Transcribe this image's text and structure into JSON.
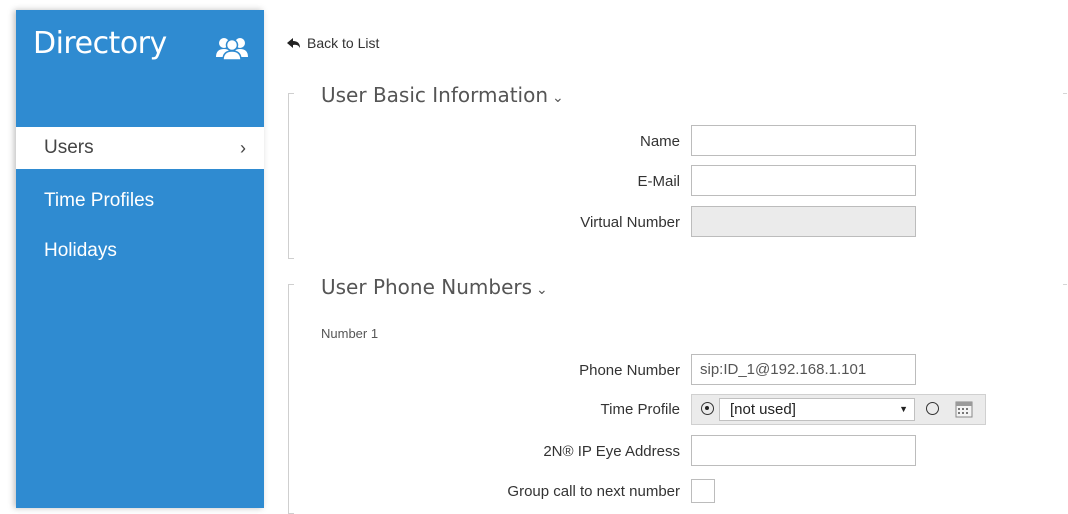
{
  "sidebar": {
    "title": "Directory",
    "icon": "users-group-icon",
    "items": [
      {
        "label": "Users",
        "active": true
      },
      {
        "label": "Time Profiles",
        "active": false
      },
      {
        "label": "Holidays",
        "active": false
      }
    ],
    "chevron": "›"
  },
  "back_link": "Back to List",
  "basic_info": {
    "title": "User Basic Information",
    "chevron": "⌄",
    "name_label": "Name",
    "name_value": "",
    "email_label": "E-Mail",
    "email_value": "",
    "virtual_number_label": "Virtual Number",
    "virtual_number_value": ""
  },
  "phone_numbers": {
    "title": "User Phone Numbers",
    "chevron": "⌄",
    "subheading": "Number 1",
    "phone_label": "Phone Number",
    "phone_value": "sip:ID_1@192.168.1.101",
    "time_profile_label": "Time Profile",
    "time_profile_value": "[not used]",
    "eye_address_label": "2N® IP Eye Address",
    "eye_address_value": "",
    "group_call_label": "Group call to next number",
    "group_call_checked": false
  },
  "colors": {
    "sidebar_bg": "#2f8bd1",
    "text": "#333333",
    "disabled_bg": "#ebebeb"
  }
}
